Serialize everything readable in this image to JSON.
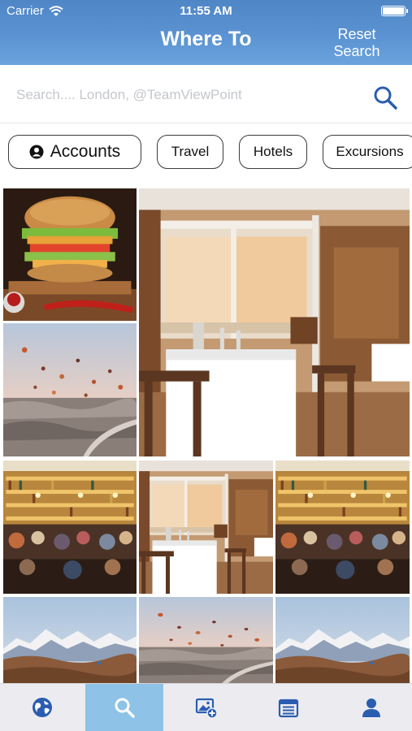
{
  "status_bar": {
    "carrier": "Carrier",
    "time": "11:55 AM"
  },
  "header": {
    "title": "Where To",
    "reset_line1": "Reset",
    "reset_line2": "Search"
  },
  "search": {
    "placeholder": "Search.... London, @TeamViewPoint",
    "value": ""
  },
  "categories": [
    {
      "label": "Accounts",
      "icon": "person-badge-icon"
    },
    {
      "label": "Travel"
    },
    {
      "label": "Hotels"
    },
    {
      "label": "Excursions"
    }
  ],
  "photos": [
    {
      "subject": "burger"
    },
    {
      "subject": "restaurant-interior",
      "size": "large"
    },
    {
      "subject": "hot-air-balloons"
    },
    {
      "subject": "bar-restaurant"
    },
    {
      "subject": "restaurant-interior"
    },
    {
      "subject": "bar-restaurant"
    },
    {
      "subject": "mountain-landscape"
    },
    {
      "subject": "hot-air-balloons"
    },
    {
      "subject": "mountain-landscape"
    }
  ],
  "tab_bar": {
    "active": "search",
    "tabs": [
      {
        "icon": "globe-icon"
      },
      {
        "icon": "search-icon"
      },
      {
        "icon": "add-photo-icon"
      },
      {
        "icon": "calendar-icon"
      },
      {
        "icon": "profile-icon"
      }
    ]
  },
  "colors": {
    "header": "#5b93d2",
    "accent": "#2a5db0",
    "active_tab": "#8ec2e6"
  }
}
